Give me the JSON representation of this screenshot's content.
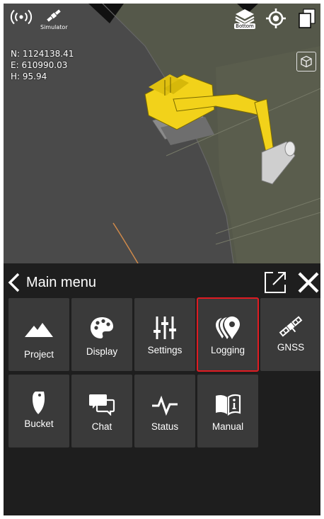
{
  "status": {
    "simulator_label": "Simulator"
  },
  "position": {
    "n": "N: 1124138.41",
    "e": "E: 610990.03",
    "h": "H: 95.94"
  },
  "view": {
    "layer_label": "Bottom"
  },
  "menu": {
    "title": "Main menu",
    "selected": "Logging",
    "items": [
      {
        "label": "Project",
        "icon": "mountain-icon"
      },
      {
        "label": "Display",
        "icon": "palette-icon"
      },
      {
        "label": "Settings",
        "icon": "sliders-icon"
      },
      {
        "label": "Logging",
        "icon": "location-pins-icon"
      },
      {
        "label": "GNSS",
        "icon": "satellite-icon"
      },
      {
        "label": "Bucket",
        "icon": "bucket-icon"
      },
      {
        "label": "Chat",
        "icon": "chat-icon"
      },
      {
        "label": "Status",
        "icon": "pulse-icon"
      },
      {
        "label": "Manual",
        "icon": "manual-icon"
      }
    ]
  },
  "colors": {
    "excavator": "#f2d21a",
    "selected_outline": "#e01b22",
    "tile": "#3a3a3a",
    "panel": "#1e1e1e"
  }
}
